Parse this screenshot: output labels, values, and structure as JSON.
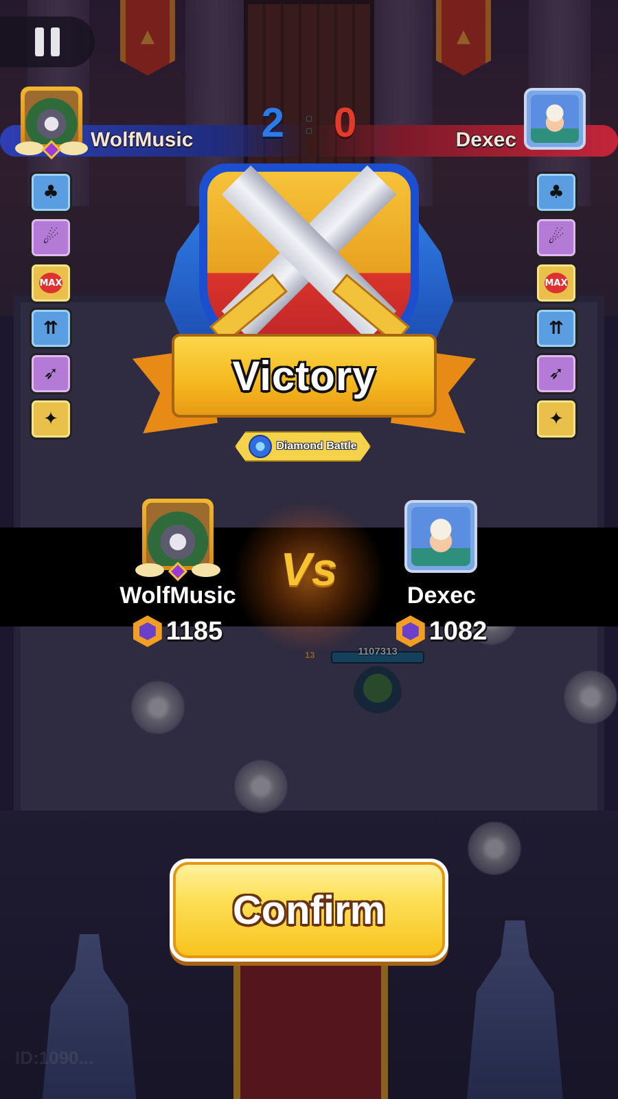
{
  "match": {
    "score_left": "2",
    "score_separator": ":",
    "score_right": "0"
  },
  "hud": {
    "left_player": "WolfMusic",
    "right_player": "Dexec"
  },
  "result": {
    "title": "Victory",
    "mode": "Diamond Battle"
  },
  "versus": {
    "label": "Vs",
    "player1": {
      "name": "WolfMusic",
      "trophies": "1185"
    },
    "player2": {
      "name": "Dexec",
      "trophies": "1082"
    }
  },
  "battle": {
    "hp_value": "1107313",
    "level": "13",
    "footer_id": "ID:1090..."
  },
  "actions": {
    "confirm_label": "Confirm"
  },
  "skills_left": [
    "clover-hooded-icon",
    "meteor-icon",
    "max-heart-icon",
    "double-arrow-icon",
    "dash-icon",
    "shuriken-icon"
  ],
  "skills_right": [
    "clover-hooded-icon",
    "meteor-icon",
    "max-heart-icon",
    "double-arrow-icon",
    "dash-icon",
    "shuriken-icon"
  ],
  "skill_max_label": "MAX",
  "colors": {
    "team_blue": "#2c7be6",
    "team_red": "#e33b2a",
    "gold": "#f7c232"
  }
}
